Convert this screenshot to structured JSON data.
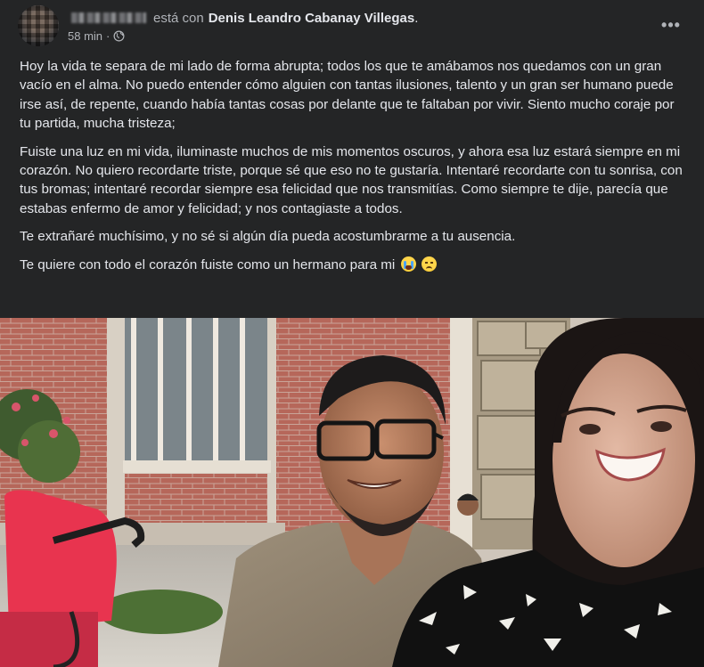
{
  "post": {
    "author_redacted": true,
    "with_text": "está con",
    "tagged_person": "Denis Leandro Cabanay Villegas",
    "tagged_suffix": ".",
    "time": "58 min",
    "separator": "·",
    "privacy_icon": "globe-icon",
    "more_label": "•••",
    "paragraphs": [
      "Hoy la vida te separa de mi lado de forma abrupta; todos los que te amábamos nos quedamos con un gran vacío en el alma. No puedo entender cómo alguien con tantas ilusiones, talento y un gran ser humano puede irse así, de repente, cuando había tantas cosas por delante que te faltaban por vivir. Siento mucho coraje por tu partida, mucha tristeza;",
      "Fuiste una luz en mi vida, iluminaste muchos de mis momentos oscuros, y ahora esa luz estará siempre en mi corazón. No quiero recordarte triste, porque sé que eso no te gustaría. Intentaré recordarte con tu sonrisa, con tus bromas; intentaré recordar siempre esa felicidad que nos transmitías. Como siempre te dije, parecía que estabas enfermo de amor y felicidad; y nos contagiaste a todos.",
      "Te extrañaré muchísimo, y no sé si algún día pueda acostumbrarme a tu ausencia."
    ],
    "last_line": "Te quiere con todo el corazón fuiste como un hermano para mi",
    "last_line_emojis": [
      "loudly-crying-face-icon",
      "sad-face-icon"
    ]
  },
  "colors": {
    "background": "#242526",
    "text": "#e4e6eb",
    "secondary_text": "#b0b3b8"
  }
}
